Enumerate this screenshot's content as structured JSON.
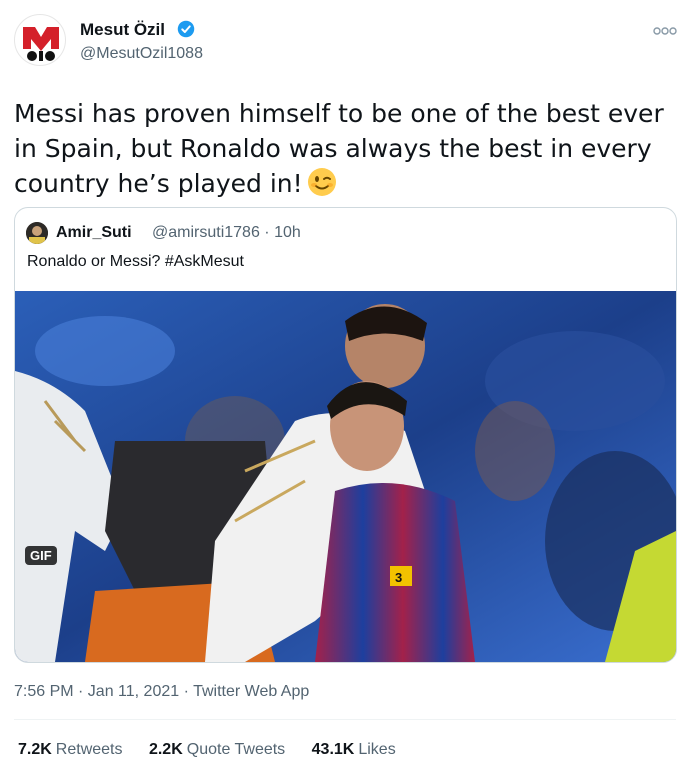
{
  "author": {
    "name": "Mesut Özil",
    "handle": "@MesutOzil1088",
    "verified": true
  },
  "tweet": {
    "text": "Messi has proven himself to be one of the best ever in Spain, but Ronaldo was always the best in every country he’s played in!",
    "emoji": "winking-face"
  },
  "quoted": {
    "name": "Amir_Suti",
    "handle_time": "@amirsuti1786 · 10h",
    "text": "Ronaldo or Messi? #AskMesut",
    "media_badge": "GIF"
  },
  "meta": {
    "timestamp": "7:56 PM · Jan 11, 2021 · Twitter Web App"
  },
  "stats": [
    {
      "count": "7.2K",
      "label": "Retweets"
    },
    {
      "count": "2.2K",
      "label": "Quote Tweets"
    },
    {
      "count": "43.1K",
      "label": "Likes"
    }
  ],
  "colors": {
    "verified": "#1d9bf0",
    "secondary_text": "#536471",
    "brand_red": "#d4202a"
  }
}
